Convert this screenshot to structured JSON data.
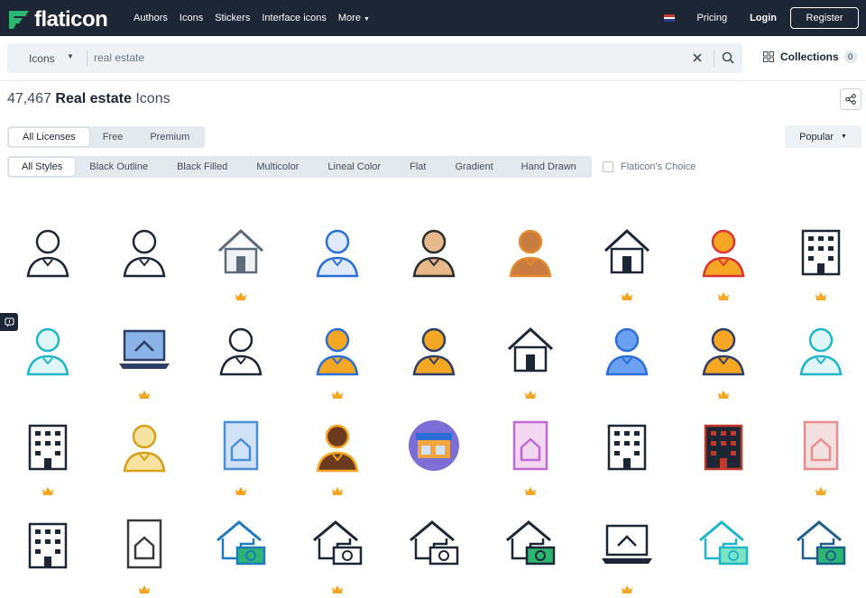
{
  "nav": {
    "logo_text": "flaticon",
    "links": [
      "Authors",
      "Icons",
      "Stickers",
      "Interface icons",
      "More"
    ],
    "pricing": "Pricing",
    "login": "Login",
    "register": "Register"
  },
  "search": {
    "type_label": "Icons",
    "query": "real estate"
  },
  "collections": {
    "label": "Collections",
    "count": "0"
  },
  "results": {
    "count": "47,467",
    "term": "Real estate",
    "suffix": "Icons"
  },
  "license_filters": [
    "All Licenses",
    "Free",
    "Premium"
  ],
  "sort": {
    "label": "Popular"
  },
  "style_filters": [
    "All Styles",
    "Black Outline",
    "Black Filled",
    "Multicolor",
    "Lineal Color",
    "Flat",
    "Gradient",
    "Hand Drawn"
  ],
  "flaticon_choice": "Flaticon's Choice",
  "colors": {
    "nav_bg": "#1d2634",
    "accent": "#2bb673",
    "crown": "#f5a623"
  },
  "icons": [
    {
      "name": "businessman-icon",
      "premium": false
    },
    {
      "name": "businesswoman-icon",
      "premium": false
    },
    {
      "name": "house-in-hand-icon",
      "premium": true
    },
    {
      "name": "businessman-blue-icon",
      "premium": false
    },
    {
      "name": "businessman-flat-icon",
      "premium": false
    },
    {
      "name": "businesswoman-flat-icon",
      "premium": false
    },
    {
      "name": "home-person-icon",
      "premium": true
    },
    {
      "name": "agent-houses-icon",
      "premium": true
    },
    {
      "name": "building-icon",
      "premium": true
    },
    {
      "name": "agent-cyan-icon",
      "premium": false
    },
    {
      "name": "laptop-house-icon",
      "premium": true
    },
    {
      "name": "agent-houses-outline-icon",
      "premium": false
    },
    {
      "name": "agent-avatar-house-icon",
      "premium": true
    },
    {
      "name": "agent-houses-color-icon",
      "premium": false
    },
    {
      "name": "home-person-filled-icon",
      "premium": true
    },
    {
      "name": "woman-blue-icon",
      "premium": false
    },
    {
      "name": "agent-woman-houses-icon",
      "premium": true
    },
    {
      "name": "woman-cyan-icon",
      "premium": false
    },
    {
      "name": "apartment-building-icon",
      "premium": true
    },
    {
      "name": "agent-gradient-icon",
      "premium": false
    },
    {
      "name": "house-document-icon",
      "premium": true
    },
    {
      "name": "woman-avatar-icon",
      "premium": true
    },
    {
      "name": "store-icon",
      "premium": false
    },
    {
      "name": "house-document-pink-icon",
      "premium": true
    },
    {
      "name": "building-settings-icon",
      "premium": false
    },
    {
      "name": "building-settings-color-icon",
      "premium": false
    },
    {
      "name": "house-document-light-icon",
      "premium": true
    },
    {
      "name": "buildings-crossed-icon",
      "premium": false
    },
    {
      "name": "house-safe-icon",
      "premium": true
    },
    {
      "name": "house-money-icon",
      "premium": false
    },
    {
      "name": "house-money-hand-icon",
      "premium": true
    },
    {
      "name": "house-money-outline-icon",
      "premium": false
    },
    {
      "name": "house-money-filled-icon",
      "premium": false
    },
    {
      "name": "laptop-home-icon",
      "premium": true
    },
    {
      "name": "house-money-cyan-icon",
      "premium": false
    },
    {
      "name": "house-money-color-icon",
      "premium": false
    }
  ]
}
